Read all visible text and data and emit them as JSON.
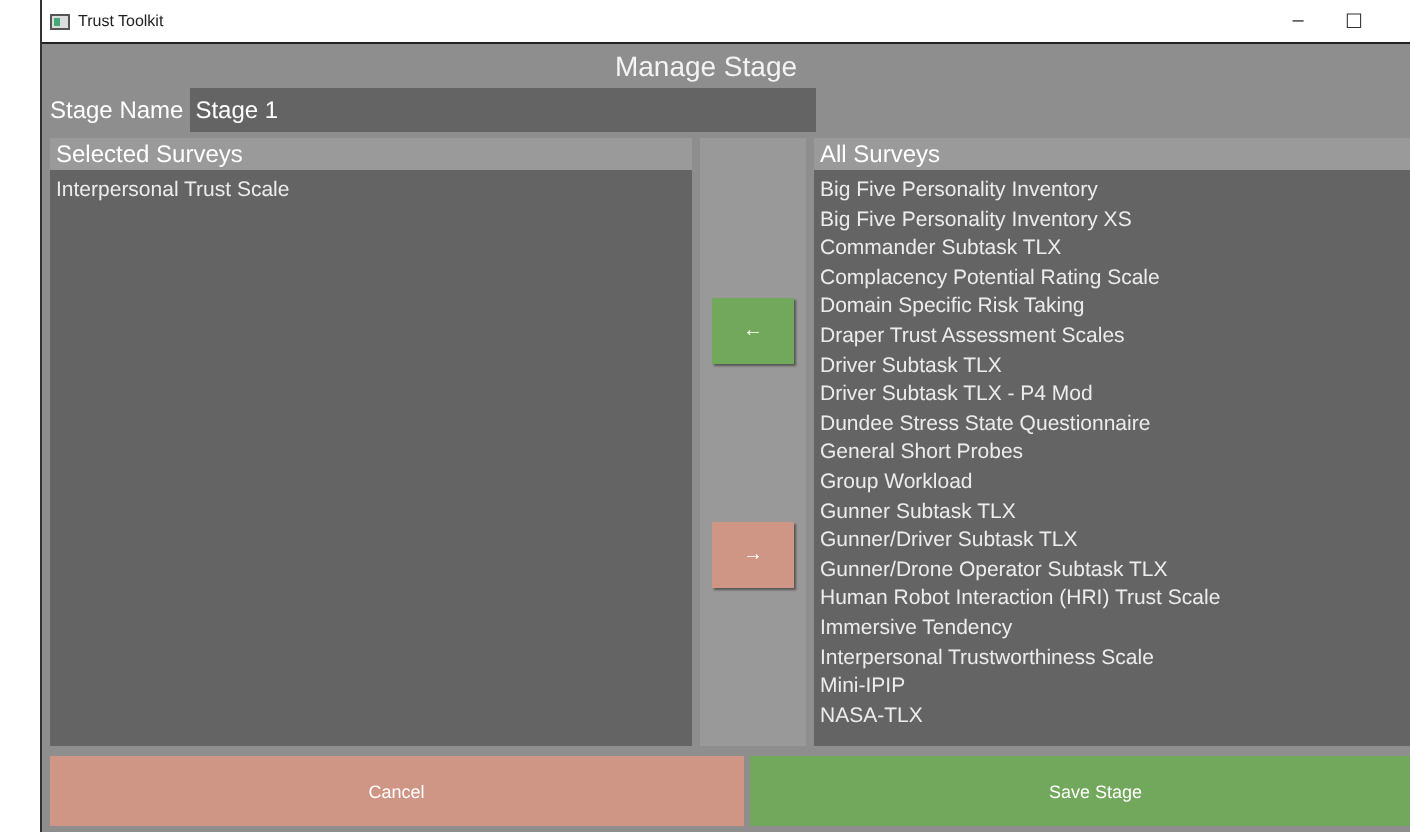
{
  "window": {
    "title": "Trust Toolkit",
    "controls": [
      "–",
      "☐"
    ]
  },
  "heading": "Manage Stage",
  "stage_name": {
    "label": "Stage Name",
    "value": "Stage 1"
  },
  "selected_surveys": {
    "header": "Selected Surveys",
    "items": [
      "Interpersonal Trust Scale"
    ]
  },
  "move_buttons": [
    {
      "label": "←",
      "kind": "add"
    },
    {
      "label": "→",
      "kind": "remove"
    }
  ],
  "all_surveys": {
    "header": "All Surveys",
    "items": [
      "Big Five Personality Inventory",
      "Big Five Personality Inventory XS",
      "Commander Subtask TLX",
      "Complacency Potential Rating Scale",
      "Domain Specific Risk Taking",
      "Draper Trust Assessment Scales",
      "Driver Subtask TLX",
      "Driver Subtask TLX - P4 Mod",
      "Dundee Stress State Questionnaire",
      "General Short Probes",
      "Group Workload",
      "Gunner Subtask TLX",
      "Gunner/Driver Subtask TLX",
      "Gunner/Drone Operator Subtask TLX",
      "Human Robot Interaction (HRI) Trust Scale",
      "Immersive Tendency",
      "Interpersonal Trustworthiness Scale",
      "Mini-IPIP",
      "NASA-TLX"
    ]
  },
  "buttons": [
    {
      "label": "Cancel",
      "kind": "cancel"
    },
    {
      "label": "Save Stage",
      "kind": "save"
    }
  ]
}
